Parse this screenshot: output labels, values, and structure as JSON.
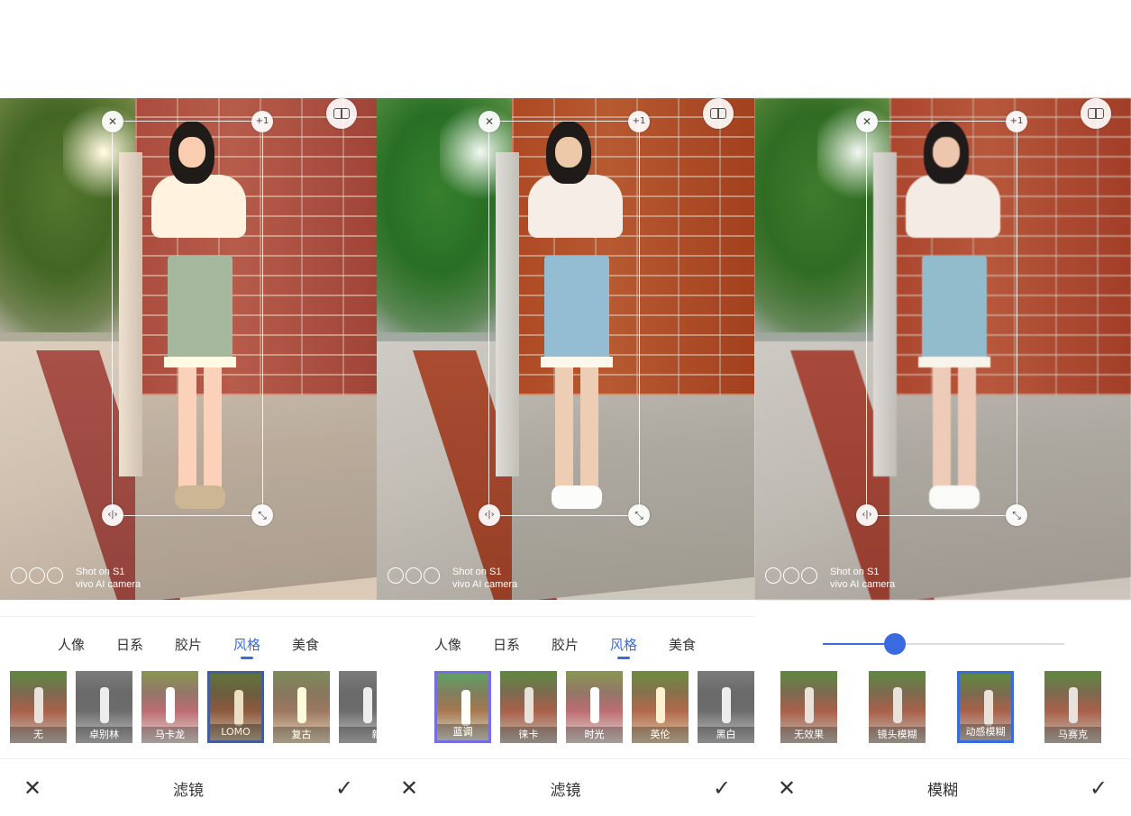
{
  "colors": {
    "accent": "#3a6ae0",
    "text": "#333333"
  },
  "watermark": {
    "line1": "Shot on S1",
    "line2": "vivo AI camera"
  },
  "overlay_handles": {
    "close": "✕",
    "add": "+1",
    "flip": "‹|›",
    "resize": "⤡"
  },
  "panels": [
    {
      "tabs": [
        "人像",
        "日系",
        "胶片",
        "风格",
        "美食"
      ],
      "active_tab": "风格",
      "thumbnails": [
        {
          "label": "无",
          "selected": false
        },
        {
          "label": "卓别林",
          "selected": false
        },
        {
          "label": "马卡龙",
          "selected": false
        },
        {
          "label": "LOMO",
          "selected": true
        },
        {
          "label": "复古",
          "selected": false
        },
        {
          "label": "新播",
          "selected": false
        }
      ],
      "bottom_title": "滤镜",
      "cancel_icon": "close-icon",
      "confirm_icon": "check-icon"
    },
    {
      "tabs": [
        "人像",
        "日系",
        "胶片",
        "风格",
        "美食"
      ],
      "active_tab": "风格",
      "thumbnails": [
        {
          "label": "蓝调",
          "selected": true
        },
        {
          "label": "徕卡",
          "selected": false
        },
        {
          "label": "时光",
          "selected": false
        },
        {
          "label": "英伦",
          "selected": false
        },
        {
          "label": "黑白",
          "selected": false
        }
      ],
      "bottom_title": "滤镜",
      "cancel_icon": "close-icon",
      "confirm_icon": "check-icon"
    },
    {
      "slider": {
        "value": 0.3
      },
      "thumbnails": [
        {
          "label": "无效果",
          "selected": false
        },
        {
          "label": "镜头模糊",
          "selected": false
        },
        {
          "label": "动感模糊",
          "selected": true
        },
        {
          "label": "马赛克",
          "selected": false
        }
      ],
      "bottom_title": "模糊",
      "cancel_icon": "close-icon",
      "confirm_icon": "check-icon"
    }
  ]
}
